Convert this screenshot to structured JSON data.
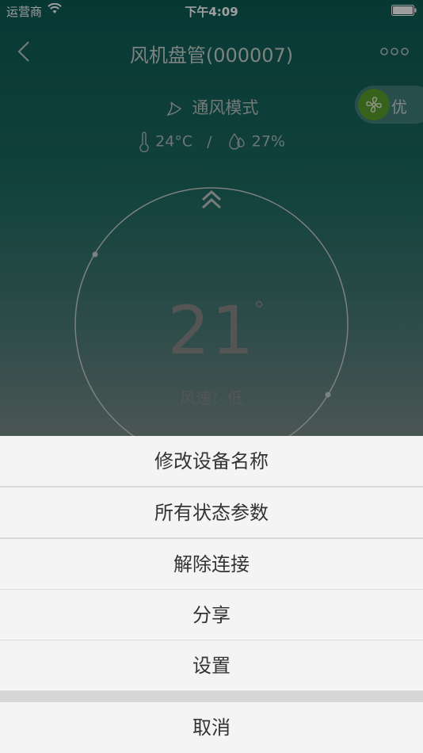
{
  "status_bar": {
    "carrier": "运营商",
    "time": "下午4:09"
  },
  "nav": {
    "title": "风机盘管(000007)"
  },
  "mode": {
    "label": "通风模式"
  },
  "eco": {
    "label": "优",
    "color": "#5a9e2e"
  },
  "sensors": {
    "temperature": "24°C",
    "separator": "/",
    "humidity": "27%"
  },
  "thermostat": {
    "setpoint": "21",
    "unit": "°",
    "wind_speed": "风速：低"
  },
  "action_sheet": {
    "items": [
      {
        "label": "修改设备名称"
      },
      {
        "label": "所有状态参数"
      },
      {
        "label": "解除连接"
      },
      {
        "label": "分享"
      },
      {
        "label": "设置"
      }
    ],
    "cancel": "取消"
  }
}
